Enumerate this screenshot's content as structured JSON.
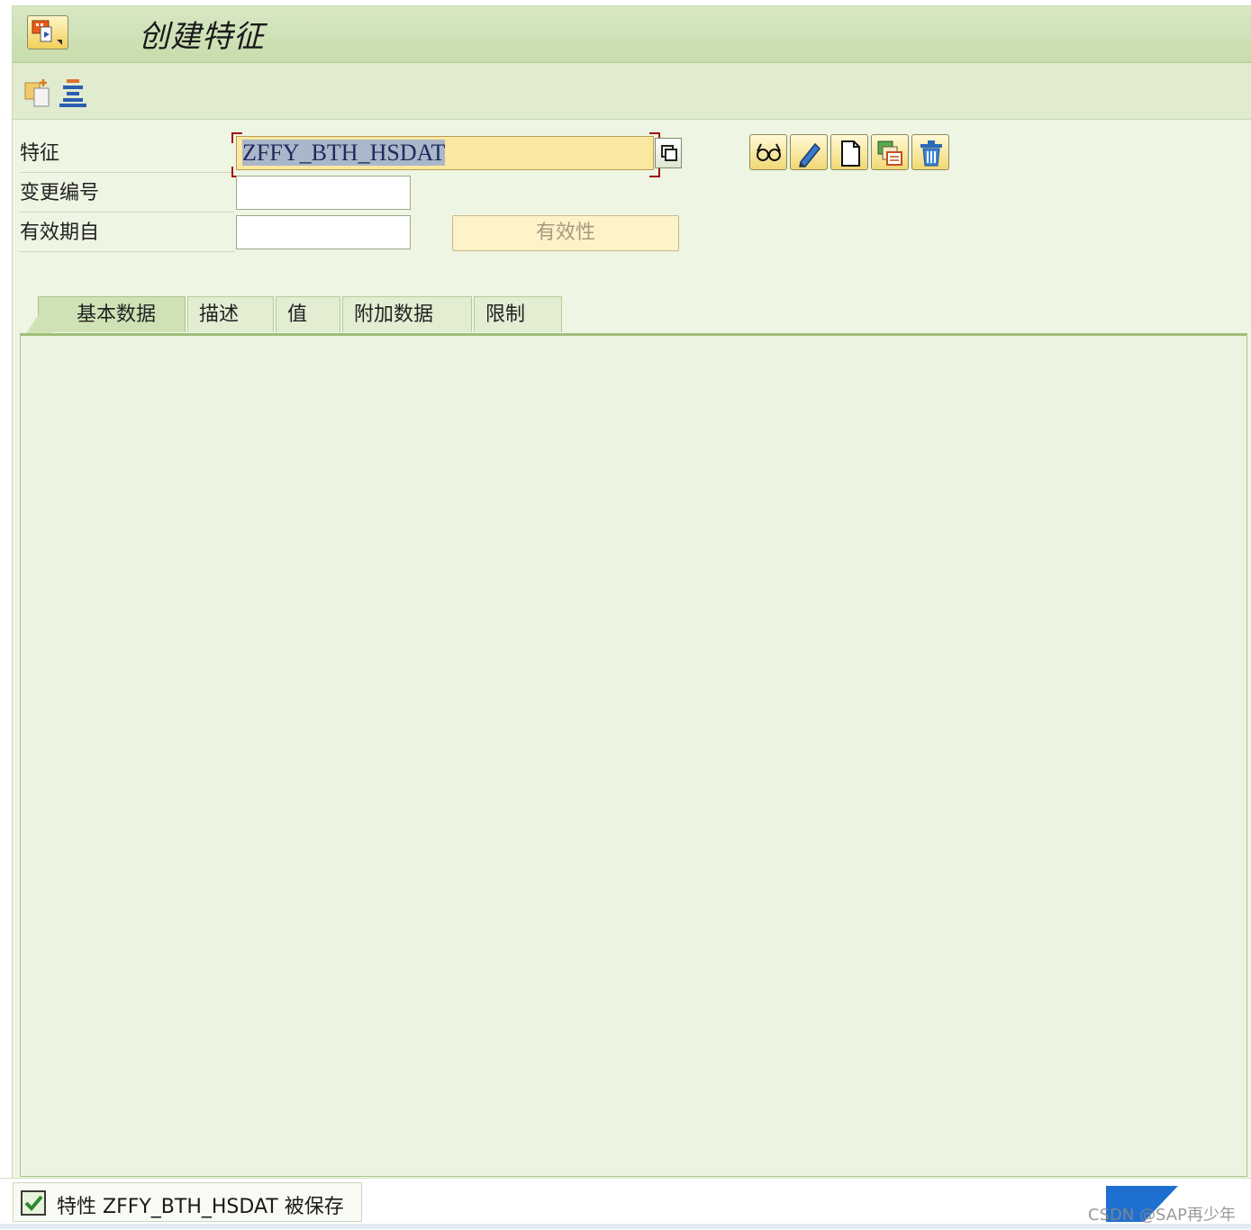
{
  "window": {
    "title": "创建特征"
  },
  "form": {
    "characteristic": {
      "label": "特征",
      "value": "ZFFY_BTH_HSDAT"
    },
    "change_number": {
      "label": "变更编号",
      "value": ""
    },
    "valid_from": {
      "label": "有效期自",
      "value": ""
    },
    "validity_button": "有效性"
  },
  "tabs": [
    {
      "label": "基本数据",
      "active": true
    },
    {
      "label": "描述",
      "active": false
    },
    {
      "label": "值",
      "active": false
    },
    {
      "label": "附加数据",
      "active": false
    },
    {
      "label": "限制",
      "active": false
    }
  ],
  "action_buttons": [
    "display-icon",
    "change-icon",
    "create-icon",
    "copy-icon",
    "delete-icon"
  ],
  "toolbar_icons": [
    "copy-object-icon",
    "hierarchy-icon"
  ],
  "status": {
    "message": "特性 ZFFY_BTH_HSDAT 被保存",
    "type": "success"
  },
  "branding": {
    "logo": "SAP",
    "watermark": "CSDN @SAP再少年"
  },
  "colors": {
    "frame_bg": "#eef5e3",
    "focused_input": "#fbe8a0",
    "button_yellow": "#f2d873",
    "sap_blue": "#1f6fd1"
  }
}
